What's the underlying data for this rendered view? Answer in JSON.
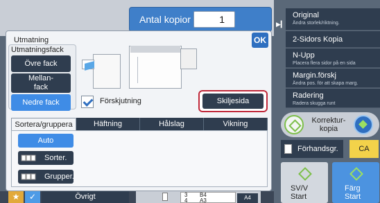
{
  "header": {
    "copies_label": "Antal kopior",
    "copies_value": "1"
  },
  "output": {
    "title": "Utmatning",
    "fack_title": "Utmatningsfack",
    "fack_options": [
      "Övre fack",
      "Mellan-\nfack",
      "Nedre fack"
    ],
    "fack_selected": "Nedre fack",
    "ok_label": "OK",
    "forskjutning_label": "Förskjutning",
    "forskjutning_checked": true,
    "skiljesida_label": "Skiljesida"
  },
  "tabs": [
    "Sortera/gruppera",
    "Häftning",
    "Hålslag",
    "Vikning"
  ],
  "active_tab": "Sortera/gruppera",
  "sort": {
    "auto_label": "Auto",
    "sorter_label": "Sorter.",
    "grupper_label": "Grupper."
  },
  "bottom": {
    "ovrigt_label": "Övrigt",
    "paper_rows": [
      [
        "3",
        "B4"
      ],
      [
        "4",
        "A3"
      ]
    ],
    "paper_selected": "A4"
  },
  "sidebar": {
    "items": [
      {
        "title": "Original",
        "subtitle": "Ändra storlek/riktning."
      },
      {
        "title": "2-Sidors Kopia",
        "subtitle": ""
      },
      {
        "title": "N-Upp",
        "subtitle": "Placera flera sidor på en sida"
      },
      {
        "title": "Margin.förskj",
        "subtitle": "Ändra pos. för att skapa marg."
      },
      {
        "title": "Radering",
        "subtitle": "Radera skugga runt"
      }
    ],
    "korrektur_label": "Korrektur-\nkopia",
    "forhand_label": "Förhandsgr.",
    "ca_label": "CA",
    "start_sv_label": "SV/V\nStart",
    "start_farg_label": "Färg\nStart"
  },
  "colors": {
    "accent_blue": "#3f8ce6",
    "dark_button": "#2f3d4f",
    "highlight_red": "#c0283a",
    "ca_yellow": "#f3d24a",
    "start_green": "#7dbf4a"
  }
}
